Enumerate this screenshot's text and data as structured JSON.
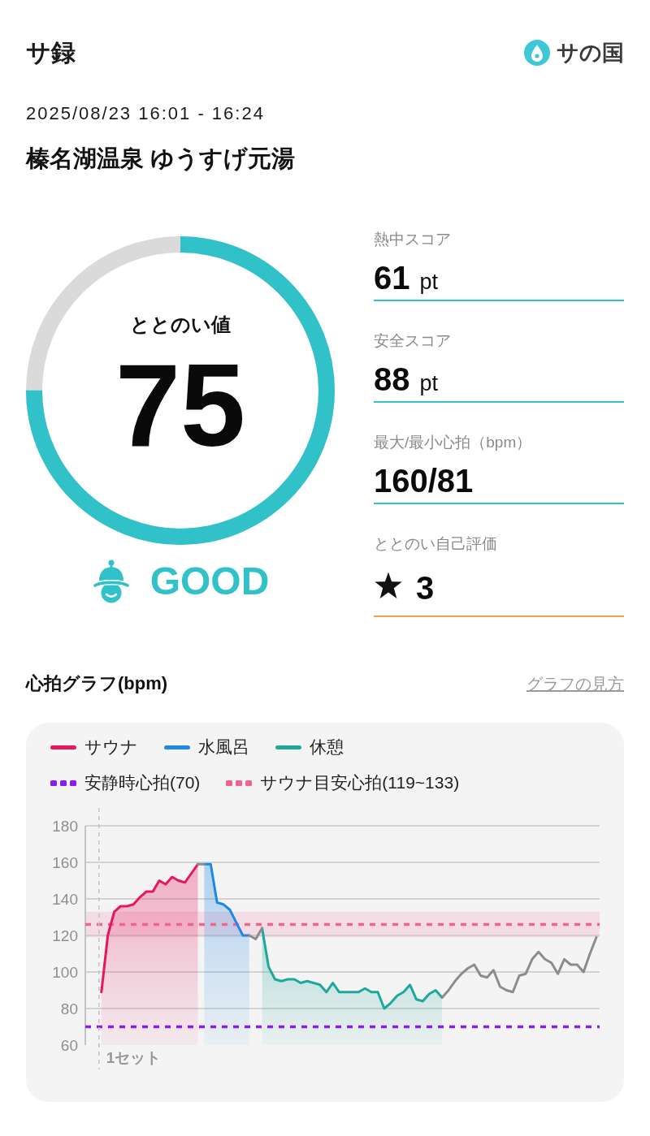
{
  "header": {
    "title": "サ録",
    "logo_text": "サの国"
  },
  "session": {
    "datetime": "2025/08/23 16:01 - 16:24",
    "facility": "榛名湖温泉 ゆうすげ元湯"
  },
  "gauge": {
    "label": "ととのい値",
    "value": "75",
    "level": 0.75,
    "verdict": "GOOD"
  },
  "metrics": [
    {
      "kind": "value",
      "label": "熱中スコア",
      "value": "61",
      "unit": "pt",
      "color": "#35c2c6"
    },
    {
      "kind": "value",
      "label": "安全スコア",
      "value": "88",
      "unit": "pt",
      "color": "#35c2c6"
    },
    {
      "kind": "value",
      "label": "最大/最小心拍（bpm）",
      "value": "160/81",
      "color": "#35c2c6"
    },
    {
      "kind": "rating",
      "label": "ととのい自己評価",
      "value": "3",
      "color": "#f5a04a"
    }
  ],
  "heart_rate": {
    "title": "心拍グラフ(bpm)",
    "link": "グラフの見方",
    "set_marker": {
      "label": "1セット"
    },
    "chart_data": {
      "type": "area",
      "grid": true,
      "ylim": [
        60,
        180
      ],
      "yticks": [
        60,
        80,
        100,
        120,
        140,
        160,
        180
      ],
      "categories": [
        null,
        null,
        null,
        null,
        null,
        null,
        null,
        null,
        null,
        null,
        null,
        null,
        null,
        null,
        null,
        null,
        null,
        null,
        null,
        null,
        null,
        null,
        null,
        null,
        null,
        null,
        null,
        null,
        null,
        null,
        null,
        null,
        null,
        null,
        null,
        null,
        null,
        null,
        null,
        null,
        null,
        null,
        null,
        null,
        null,
        null,
        null,
        null,
        null,
        null,
        null,
        null,
        null,
        null,
        null,
        null,
        null,
        null,
        null,
        null,
        null,
        null,
        null,
        null,
        null,
        null,
        null,
        null,
        null,
        null,
        null,
        null,
        null,
        null,
        null,
        null,
        null,
        null,
        null,
        null
      ],
      "series": [
        {
          "name": "サウナ",
          "color": "#e8175d",
          "values": [
            null,
            null,
            89,
            120,
            133,
            136,
            136,
            137,
            141,
            144,
            144,
            150,
            148,
            152,
            150,
            149,
            154,
            159,
            null,
            null,
            null,
            null,
            null,
            null,
            null,
            null,
            null,
            null,
            null,
            null,
            null,
            null,
            null,
            null,
            null,
            null,
            null,
            null,
            null,
            null,
            null,
            null,
            null,
            null,
            null,
            null,
            null,
            null,
            null,
            null,
            null,
            null,
            null,
            null,
            null,
            null,
            null,
            null,
            null,
            null,
            null,
            null,
            null,
            null,
            null,
            null,
            null,
            null,
            null,
            null,
            null,
            null,
            null,
            null,
            null,
            null,
            null,
            null,
            null,
            null
          ]
        },
        {
          "name": "水風呂",
          "color": "#1e88e5",
          "values": [
            null,
            null,
            null,
            null,
            null,
            null,
            null,
            null,
            null,
            null,
            null,
            null,
            null,
            null,
            null,
            null,
            null,
            null,
            159,
            159,
            138,
            137,
            134,
            127,
            120,
            120,
            null,
            null,
            null,
            null,
            null,
            null,
            null,
            null,
            null,
            null,
            null,
            null,
            null,
            null,
            null,
            null,
            null,
            null,
            null,
            null,
            null,
            null,
            null,
            null,
            null,
            null,
            null,
            null,
            null,
            null,
            null,
            null,
            null,
            null,
            null,
            null,
            null,
            null,
            null,
            null,
            null,
            null,
            null,
            null,
            null,
            null,
            null,
            null,
            null,
            null,
            null,
            null,
            null,
            null
          ]
        },
        {
          "name": "休憩",
          "color": "#1ea89c",
          "values": [
            null,
            null,
            null,
            null,
            null,
            null,
            null,
            null,
            null,
            null,
            null,
            null,
            null,
            null,
            null,
            null,
            null,
            null,
            null,
            null,
            null,
            null,
            null,
            null,
            null,
            null,
            null,
            124,
            103,
            96,
            95,
            96,
            96,
            94,
            95,
            94,
            93,
            89,
            94,
            89,
            89,
            89,
            89,
            91,
            89,
            89,
            80,
            83,
            87,
            89,
            93,
            85,
            84,
            88,
            90,
            86,
            null,
            null,
            null,
            null,
            null,
            null,
            null,
            null,
            null,
            null,
            null,
            null,
            null,
            null,
            null,
            null,
            null,
            null,
            null,
            null,
            null,
            null,
            null,
            null
          ]
        },
        {
          "type": "line",
          "color": "#8c8c8c",
          "values": [
            null,
            null,
            null,
            null,
            null,
            null,
            null,
            null,
            null,
            null,
            null,
            null,
            null,
            null,
            null,
            null,
            null,
            159,
            159,
            null,
            null,
            null,
            null,
            null,
            null,
            120,
            118,
            124,
            null,
            null,
            null,
            null,
            null,
            null,
            null,
            null,
            null,
            null,
            null,
            null,
            null,
            null,
            null,
            null,
            null,
            null,
            null,
            null,
            null,
            null,
            null,
            null,
            null,
            null,
            null,
            86,
            90,
            95,
            99,
            102,
            104,
            98,
            97,
            101,
            92,
            90,
            89,
            98,
            99,
            107,
            111,
            107,
            105,
            99,
            107,
            104,
            104,
            100,
            110,
            119
          ]
        }
      ],
      "ref_lines": [
        {
          "axis": "y",
          "value": 70,
          "label": "安静時心拍(70)",
          "color": "#8a1cf0"
        },
        {
          "axis": "y",
          "value": 126,
          "color": "#f2648f"
        }
      ],
      "bands": [
        {
          "axis": "y",
          "from": 119,
          "to": 133,
          "label": "サウナ目安心拍(119~133)",
          "color": "#f2648f"
        }
      ]
    }
  }
}
